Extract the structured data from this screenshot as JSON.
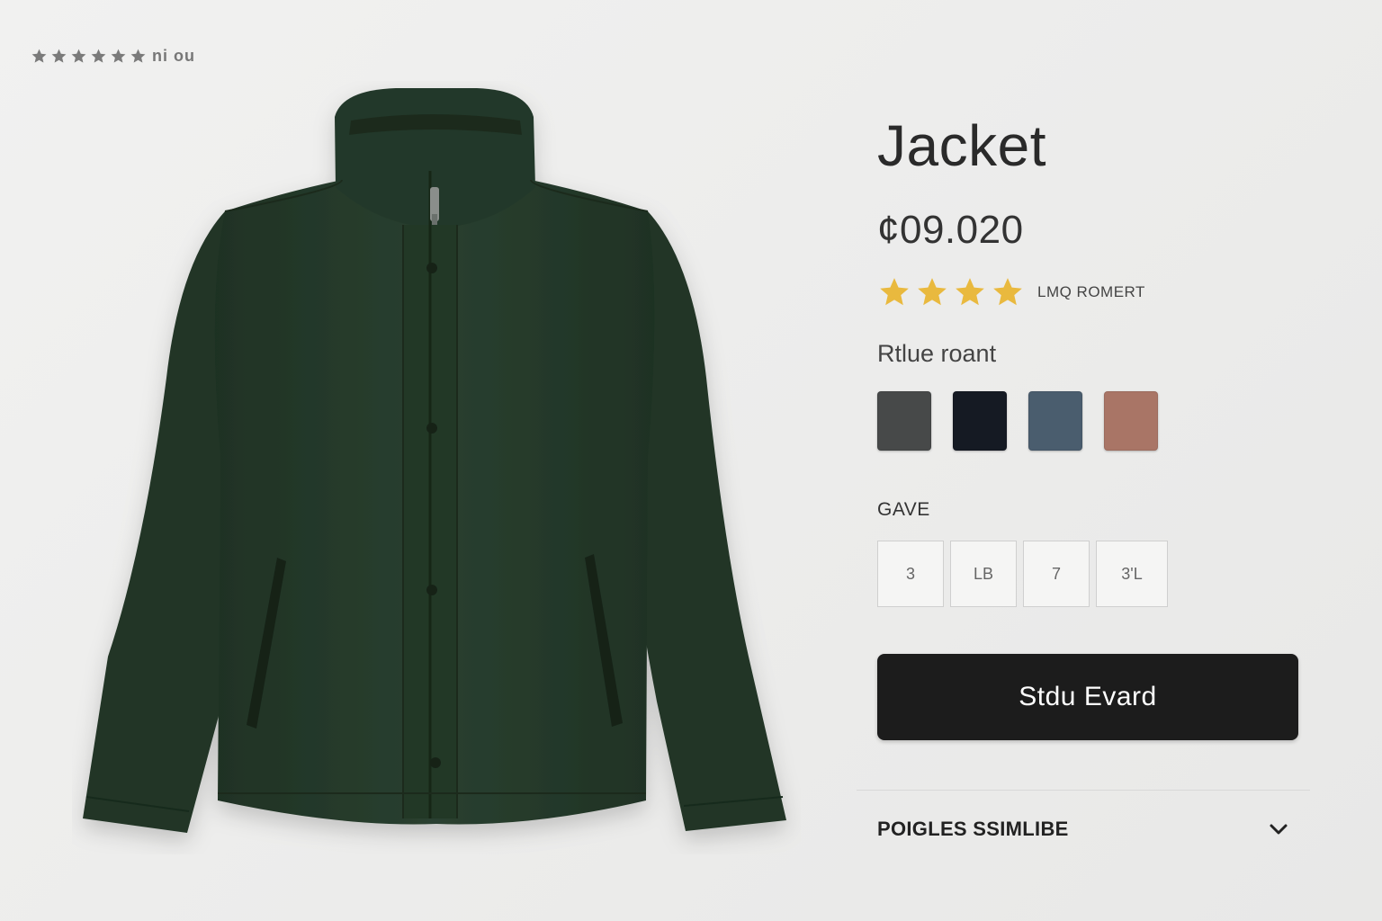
{
  "top_rating": {
    "star_count": 6,
    "text": "ni ou",
    "star_color": "#7a7a7a"
  },
  "product": {
    "title": "Jacket",
    "price": "¢09.020",
    "rating": {
      "stars": 4,
      "star_color": "#e9b93e",
      "text": "LMQ ROMERT"
    },
    "color_label": "Rtlue roant",
    "colors": [
      {
        "name": "charcoal",
        "hex": "#474949"
      },
      {
        "name": "navy-black",
        "hex": "#151a23"
      },
      {
        "name": "slate-blue",
        "hex": "#4a5d6e"
      },
      {
        "name": "terracotta",
        "hex": "#a97566"
      }
    ],
    "image": {
      "jacket_color": "#263a2b"
    },
    "size_label": "GAVE",
    "sizes": [
      "3",
      "LB",
      "7",
      "3'L"
    ],
    "add_button_label": "Stdu Evard",
    "accordion_label": "POIGLES SSIMLIBE"
  }
}
